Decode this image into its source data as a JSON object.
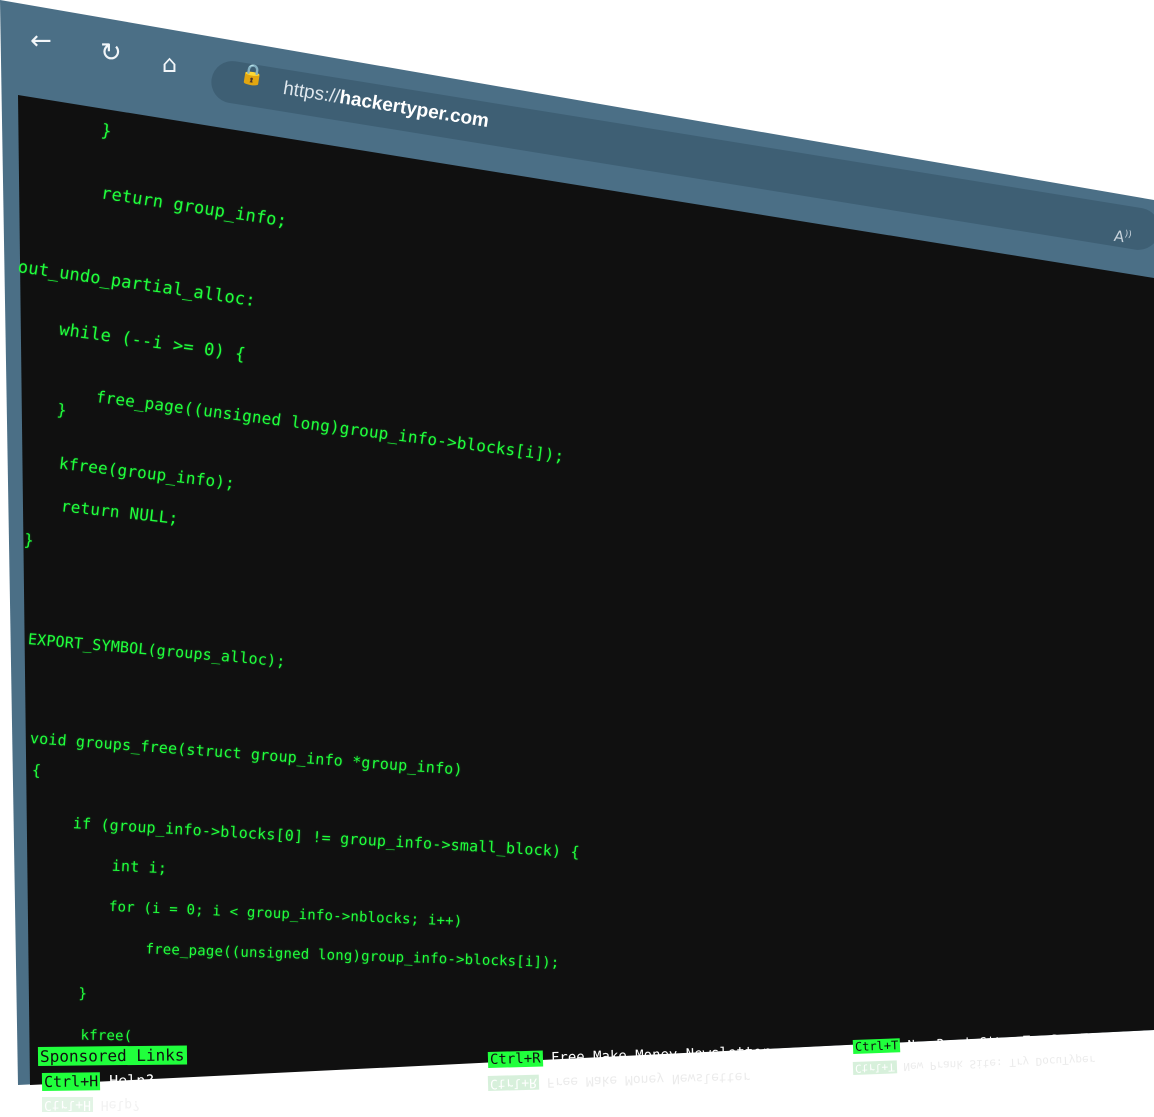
{
  "browser": {
    "url_prefix": "https://",
    "url_host": "hackertyper.com",
    "nav_icons": [
      "back-arrow-icon",
      "refresh-icon",
      "home-icon",
      "lock-icon",
      "read-aloud-icon"
    ],
    "back_glyph": "←",
    "refresh_glyph": "↻",
    "home_glyph": "⌂",
    "lock_glyph": "🔒",
    "read_aloud_glyph": "A⁾"
  },
  "code": {
    "lines": [
      "    }",
      "    return group_info;",
      "out_undo_partial_alloc:",
      "    while (--i >= 0) {",
      "        free_page((unsigned long)group_info->blocks[i]);",
      "    }",
      "    kfree(group_info);",
      "    return NULL;",
      "}",
      "EXPORT_SYMBOL(groups_alloc);",
      "void groups_free(struct group_info *group_info)",
      "{",
      "    if (group_info->blocks[0] != group_info->small_block) {",
      "        int i;",
      "        for (i = 0; i < group_info->nblocks; i++)",
      "            free_page((unsigned long)group_info->blocks[i]);",
      "    }",
      "    kfree("
    ]
  },
  "footer": {
    "sponsored_links": "Sponsored Links",
    "help_key": "Ctrl+H",
    "help_label": "Help?",
    "newsletter_key": "Ctrl+R",
    "newsletter_label": "Free Make Money Newsletter",
    "prank_key": "Ctrl+T",
    "prank_label": "New Prank Site: Try DocuTyper"
  },
  "colors": {
    "terminal_green": "#20ff3c",
    "terminal_bg": "#101010",
    "browser_chrome": "#4b6f86"
  }
}
